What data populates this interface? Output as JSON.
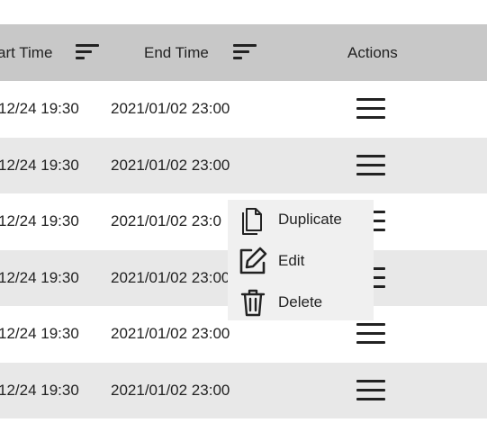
{
  "table": {
    "headers": {
      "start_time": "art Time",
      "end_time": "End Time",
      "actions": "Actions"
    },
    "rows": [
      {
        "start": "12/24 19:30",
        "end": "2021/01/02 23:00"
      },
      {
        "start": "12/24 19:30",
        "end": "2021/01/02 23:00"
      },
      {
        "start": "12/24 19:30",
        "end": "2021/01/02 23:0"
      },
      {
        "start": "12/24 19:30",
        "end": "2021/01/02 23:00"
      },
      {
        "start": "12/24 19:30",
        "end": "2021/01/02 23:00"
      },
      {
        "start": "12/24 19:30",
        "end": "2021/01/02 23:00"
      }
    ]
  },
  "context_menu": {
    "items": [
      {
        "label": "Duplicate",
        "icon": "duplicate-icon"
      },
      {
        "label": "Edit",
        "icon": "edit-icon"
      },
      {
        "label": "Delete",
        "icon": "delete-icon"
      }
    ]
  },
  "colors": {
    "header_bg": "#c8c8c8",
    "row_alt_bg": "#e8e8e8",
    "menu_bg": "#f0f0f0",
    "text": "#222222"
  }
}
